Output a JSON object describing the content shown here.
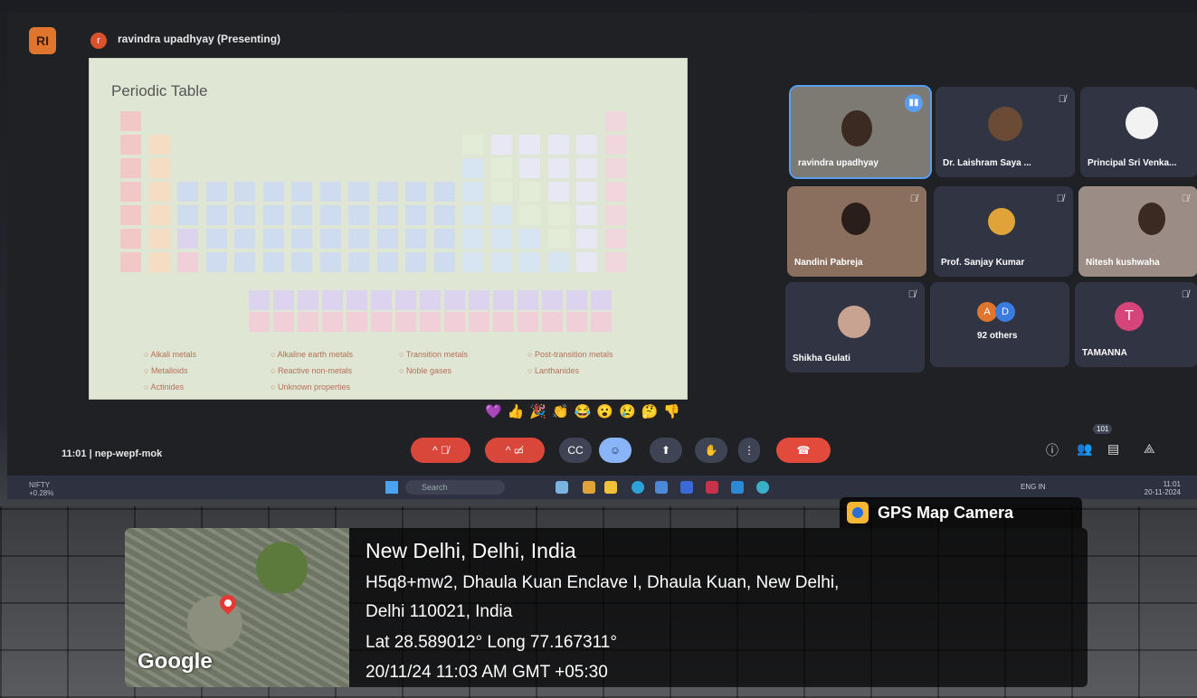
{
  "meeting": {
    "logo_text": "RI",
    "presenter_initial": "r",
    "presenter_label": "ravindra upadhyay (Presenting)",
    "time_code": "11:01 | nep-wepf-mok",
    "participant_count_badge": "101",
    "emoji_reactions": "💜👍🎉👏😂😮😢🤔👎"
  },
  "slide": {
    "title": "Periodic Table",
    "legend": [
      "Alkali metals",
      "Alkaline earth metals",
      "Transition metals",
      "Post-transition metals",
      "Metalloids",
      "Reactive non-metals",
      "Noble gases",
      "Lanthanides",
      "Actinides",
      "Unknown properties"
    ]
  },
  "participants": [
    {
      "name": "ravindra upadhyay"
    },
    {
      "name": "Dr. Laishram Saya ..."
    },
    {
      "name": "Principal Sri Venka..."
    },
    {
      "name": "Nandini Pabreja"
    },
    {
      "name": "Prof. Sanjay Kumar"
    },
    {
      "name": "Nitesh kushwaha"
    },
    {
      "name": "Shikha Gulati"
    },
    {
      "name": "92 others",
      "initials": [
        "A",
        "D"
      ]
    },
    {
      "name": "TAMANNA",
      "initial": "T"
    }
  ],
  "taskbar": {
    "nifty_label": "NIFTY",
    "nifty_change": "+0.28%",
    "search_placeholder": "Search",
    "lang": "ENG",
    "region": "IN",
    "time": "11:01",
    "date": "20-11-2024"
  },
  "gps": {
    "app_label": "GPS Map Camera",
    "city": "New Delhi, Delhi, India",
    "address_line1": "H5q8+mw2, Dhaula Kuan Enclave I, Dhaula Kuan, New Delhi,",
    "address_line2": "Delhi 110021, India",
    "coords": "Lat 28.589012° Long 77.167311°",
    "timestamp": "20/11/24 11:03 AM GMT +05:30",
    "map_brand": "Google"
  },
  "colors": {
    "accent_orange": "#e0762d",
    "end_call_red": "#e24b3b",
    "active_blue": "#5a9ef0"
  }
}
